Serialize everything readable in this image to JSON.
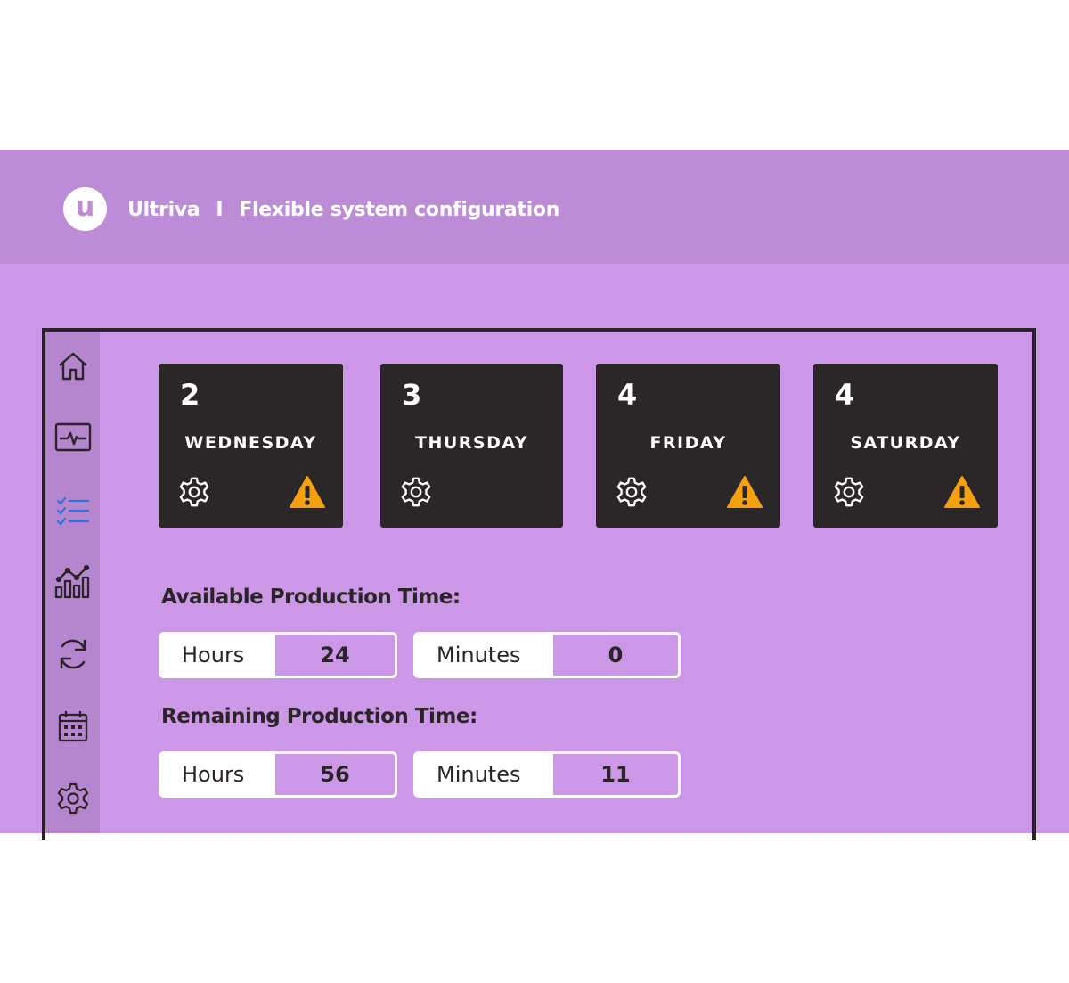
{
  "header": {
    "brand": "Ultriva",
    "separator": "I",
    "title": "Flexible system configuration",
    "logo_letter": "u"
  },
  "colors": {
    "header_bg": "#bc8dd6",
    "canvas_bg": "#cc97e6",
    "sidebar_bg": "#b586cd",
    "card_bg": "#2b2628",
    "warning": "#f5a00f",
    "active_icon": "#2f73e0"
  },
  "sidebar": {
    "items": [
      {
        "icon": "home-icon",
        "active": false
      },
      {
        "icon": "monitor-pulse-icon",
        "active": false
      },
      {
        "icon": "checklist-icon",
        "active": true
      },
      {
        "icon": "analytics-chart-icon",
        "active": false
      },
      {
        "icon": "refresh-icon",
        "active": false
      },
      {
        "icon": "calendar-icon",
        "active": false
      },
      {
        "icon": "gear-icon",
        "active": false
      }
    ]
  },
  "days": [
    {
      "count": "2",
      "day": "WEDNESDAY",
      "warning": true
    },
    {
      "count": "3",
      "day": "THURSDAY",
      "warning": false
    },
    {
      "count": "4",
      "day": "FRIDAY",
      "warning": true
    },
    {
      "count": "4",
      "day": "SATURDAY",
      "warning": true
    }
  ],
  "available": {
    "title": "Available Production Time:",
    "hours_label": "Hours",
    "hours_value": "24",
    "minutes_label": "Minutes",
    "minutes_value": "0"
  },
  "remaining": {
    "title": "Remaining Production Time:",
    "hours_label": "Hours",
    "hours_value": "56",
    "minutes_label": "Minutes",
    "minutes_value": "11"
  }
}
